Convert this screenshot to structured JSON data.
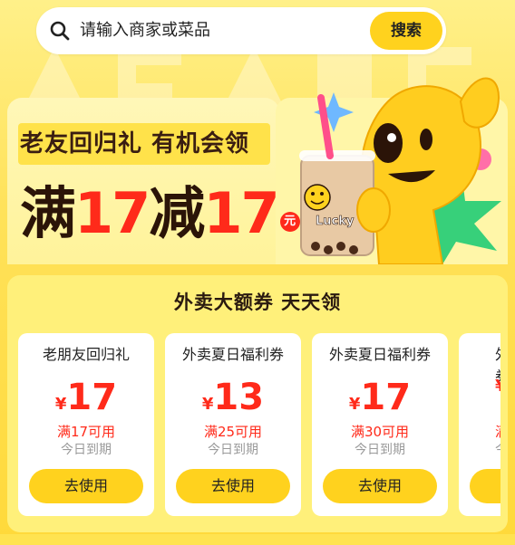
{
  "search": {
    "placeholder": "请输入商家或菜品",
    "button_label": "搜索"
  },
  "banner": {
    "subtitle": "老友回归礼 有机会领",
    "offer_parts": [
      "满",
      "17",
      "减",
      "17"
    ],
    "offer_unit": "元",
    "cup_label": "Lucky"
  },
  "coupons": {
    "header": "外卖大额券  天天领",
    "currency_symbol": "¥",
    "items": [
      {
        "title": "老朋友回归礼",
        "amount": "17",
        "condition": "满17可用",
        "expiry": "今日到期",
        "action": "去使用"
      },
      {
        "title": "外卖夏日福利券",
        "amount": "13",
        "condition": "满25可用",
        "expiry": "今日到期",
        "action": "去使用"
      },
      {
        "title": "外卖夏日福利券",
        "amount": "17",
        "condition": "满30可用",
        "expiry": "今日到期",
        "action": "去使用"
      },
      {
        "title": "外卖夏日福利券",
        "amount": "",
        "condition": "满",
        "expiry": "今",
        "action": ""
      }
    ]
  },
  "colors": {
    "accent_yellow": "#ffd21e",
    "price_red": "#ff2a1a",
    "background": "#ffe866"
  }
}
